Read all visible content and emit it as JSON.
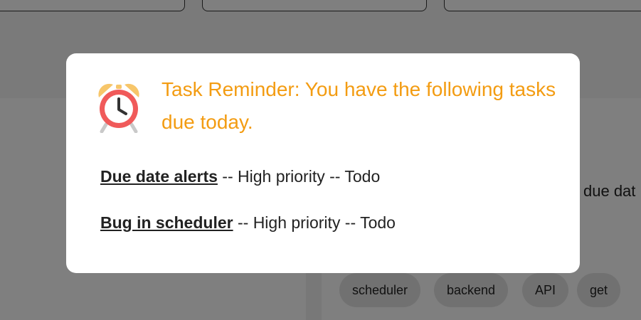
{
  "background": {
    "partial_text": "due dat",
    "tags": [
      "scheduler",
      "backend",
      "API",
      "get"
    ]
  },
  "modal": {
    "title": "Task Reminder: You have the following tasks due today.",
    "icon": "alarm-clock-icon",
    "tasks": [
      {
        "name": "Due date alerts",
        "details": " -- High priority -- Todo"
      },
      {
        "name": "Bug in scheduler",
        "details": " -- High priority -- Todo"
      }
    ]
  },
  "colors": {
    "title": "#f39c12",
    "clock_face": "#f05a5a",
    "clock_bells": "#f7c66a"
  }
}
